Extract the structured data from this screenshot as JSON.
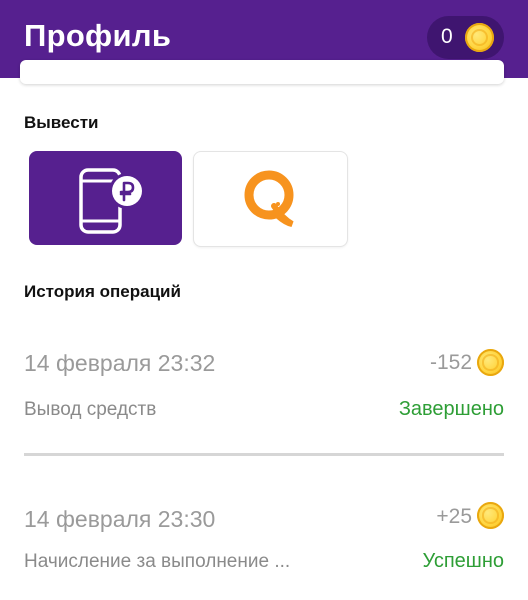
{
  "appbar": {
    "title": "Профиль",
    "balance": "0",
    "balance_icon": "coin-icon"
  },
  "withdraw": {
    "title": "Вывести",
    "methods": [
      {
        "icon": "mobile-payment-icon",
        "selected": true
      },
      {
        "icon": "qiwi-logo-icon",
        "selected": false
      }
    ]
  },
  "history": {
    "title": "История операций",
    "items": [
      {
        "date": "14 февраля 23:32",
        "amount": "-152",
        "description": "Вывод средств",
        "status": "Завершено"
      },
      {
        "date": "14 февраля 23:30",
        "amount": "+25",
        "description": "Начисление за выполнение ...",
        "status": "Успешно"
      }
    ]
  },
  "colors": {
    "brand": "#56208f",
    "brand_dark": "#3f1570",
    "status_success": "#2e9e36",
    "coin": "#ffd43c",
    "qiwi": "#f7931e"
  }
}
